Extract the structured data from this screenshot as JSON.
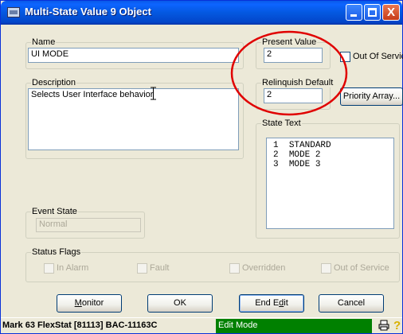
{
  "window": {
    "title": "Multi-State Value 9 Object",
    "close_glyph": "X"
  },
  "name_group": {
    "label": "Name",
    "value": "UI MODE"
  },
  "present_value_group": {
    "label": "Present Value",
    "value": "2"
  },
  "out_of_service": {
    "label": "Out Of Service",
    "checked": false
  },
  "description_group": {
    "label": "Description",
    "value": "Selects User Interface behavior"
  },
  "relinquish_group": {
    "label": "Relinquish Default",
    "value": "2"
  },
  "priority_button": {
    "label": "Priority Array..."
  },
  "state_text_group": {
    "label": "State Text",
    "items": [
      {
        "num": "1",
        "text": "STANDARD"
      },
      {
        "num": "2",
        "text": "MODE 2"
      },
      {
        "num": "3",
        "text": "MODE 3"
      }
    ]
  },
  "event_state_group": {
    "label": "Event State",
    "value": "Normal"
  },
  "status_flags_group": {
    "label": "Status Flags",
    "flags": [
      "In Alarm",
      "Fault",
      "Overridden",
      "Out of Service"
    ]
  },
  "buttons": {
    "monitor_pre": "",
    "monitor_accel": "M",
    "monitor_post": "onitor",
    "ok": "OK",
    "end_edit_pre": "End E",
    "end_edit_accel": "d",
    "end_edit_post": "it",
    "cancel": "Cancel"
  },
  "status_bar": {
    "device": "Mark 63 FlexStat [81113] BAC-11163C",
    "mode": "Edit Mode",
    "mode_color": "#008000",
    "help_glyph": "?"
  },
  "annotation": {
    "color": "#e00000",
    "shape": "ellipse"
  }
}
